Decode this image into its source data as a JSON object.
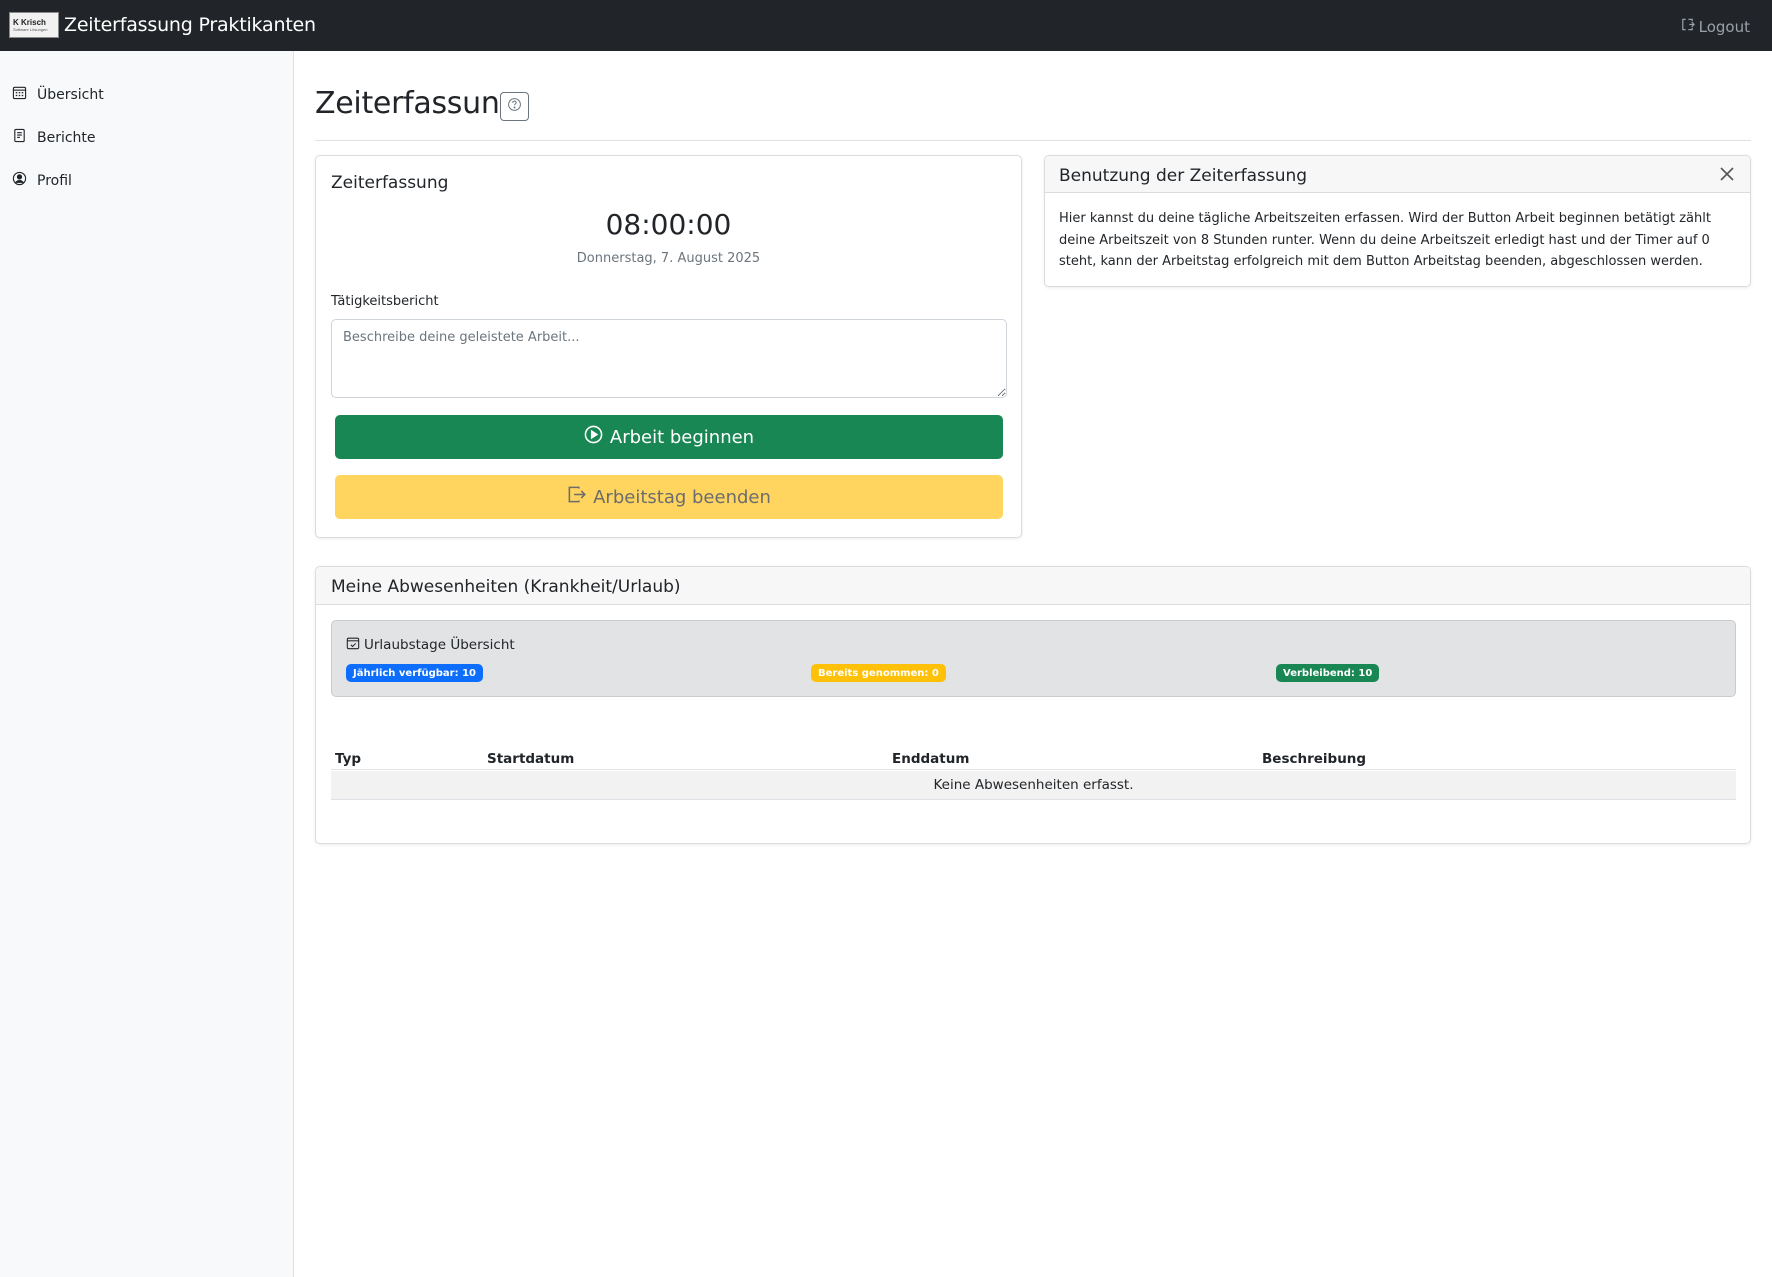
{
  "navbar": {
    "logo": {
      "line1": "K Krisch",
      "line2": "Software Lösungen"
    },
    "title": "Zeiterfassung Praktikanten",
    "logout_label": "Logout"
  },
  "sidebar": {
    "items": [
      {
        "label": "Übersicht",
        "icon": "calendar-icon"
      },
      {
        "label": "Berichte",
        "icon": "document-icon"
      },
      {
        "label": "Profil",
        "icon": "person-circle-icon"
      }
    ]
  },
  "main": {
    "page_title": "Zeiterfassung",
    "time_card": {
      "title": "Zeiterfassung",
      "timer": "08:00:00",
      "date": "Donnerstag, 7. August 2025",
      "report_label": "Tätigkeitsbericht",
      "report_placeholder": "Beschreibe deine geleistete Arbeit...",
      "start_button": "Arbeit beginnen",
      "end_button": "Arbeitstag beenden"
    },
    "info_card": {
      "title": "Benutzung der Zeiterfassung",
      "text": "Hier kannst du deine tägliche Arbeitszeiten erfassen. Wird der Button Arbeit beginnen betätigt zählt deine Arbeitszeit von 8 Stunden runter. Wenn du deine Arbeitszeit erledigt hast und der Timer auf 0 steht, kann der Arbeitstag erfolgreich mit dem Button Arbeitstag beenden, abgeschlossen werden."
    },
    "absences": {
      "title": "Meine Abwesenheiten (Krankheit/Urlaub)",
      "vacation_title": "Urlaubstage Übersicht",
      "badges": {
        "available": "Jährlich verfügbar: 10",
        "taken": "Bereits genommen: 0",
        "remaining": "Verbleibend: 10"
      },
      "columns": [
        "Typ",
        "Startdatum",
        "Enddatum",
        "Beschreibung"
      ],
      "empty_text": "Keine Abwesenheiten erfasst."
    }
  },
  "colors": {
    "navbar": "#212529",
    "success": "#198754",
    "warning": "#ffd560",
    "primary": "#0d6efd"
  }
}
